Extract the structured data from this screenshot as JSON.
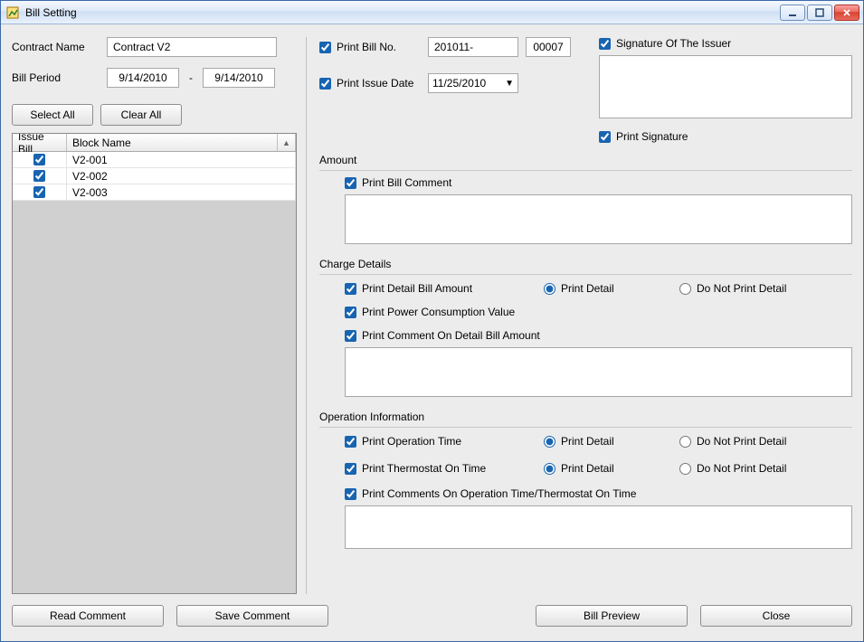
{
  "window": {
    "title": "Bill Setting"
  },
  "left": {
    "contract_label": "Contract Name",
    "contract_value": "Contract V2",
    "period_label": "Bill Period",
    "period_from": "9/14/2010",
    "period_sep": "-",
    "period_to": "9/14/2010",
    "select_all": "Select All",
    "clear_all": "Clear All",
    "grid": {
      "col_issue": "Issue Bill",
      "col_block": "Block Name",
      "rows": [
        {
          "checked": true,
          "name": "V2-001"
        },
        {
          "checked": true,
          "name": "V2-002"
        },
        {
          "checked": true,
          "name": "V2-003"
        }
      ]
    }
  },
  "bill_no": {
    "label": "Print Bill No.",
    "prefix": "201011-",
    "seq": "00007"
  },
  "issue_date": {
    "label": "Print Issue Date",
    "value": "11/25/2010"
  },
  "signature": {
    "label": "Signature Of The Issuer",
    "print_label": "Print Signature"
  },
  "amount": {
    "title": "Amount",
    "print_comment": "Print Bill Comment"
  },
  "charge": {
    "title": "Charge Details",
    "detail_amount": "Print Detail Bill Amount",
    "print_detail": "Print Detail",
    "not_print_detail": "Do Not Print Detail",
    "power": "Print Power Consumption Value",
    "comment_detail": "Print Comment On Detail Bill Amount"
  },
  "operation": {
    "title": "Operation Information",
    "op_time": "Print Operation Time",
    "thermo": "Print Thermostat On Time",
    "print_detail": "Print Detail",
    "not_print_detail": "Do Not Print Detail",
    "comments": "Print Comments On Operation Time/Thermostat On Time"
  },
  "buttons": {
    "read_comment": "Read Comment",
    "save_comment": "Save Comment",
    "preview": "Bill Preview",
    "close": "Close"
  }
}
